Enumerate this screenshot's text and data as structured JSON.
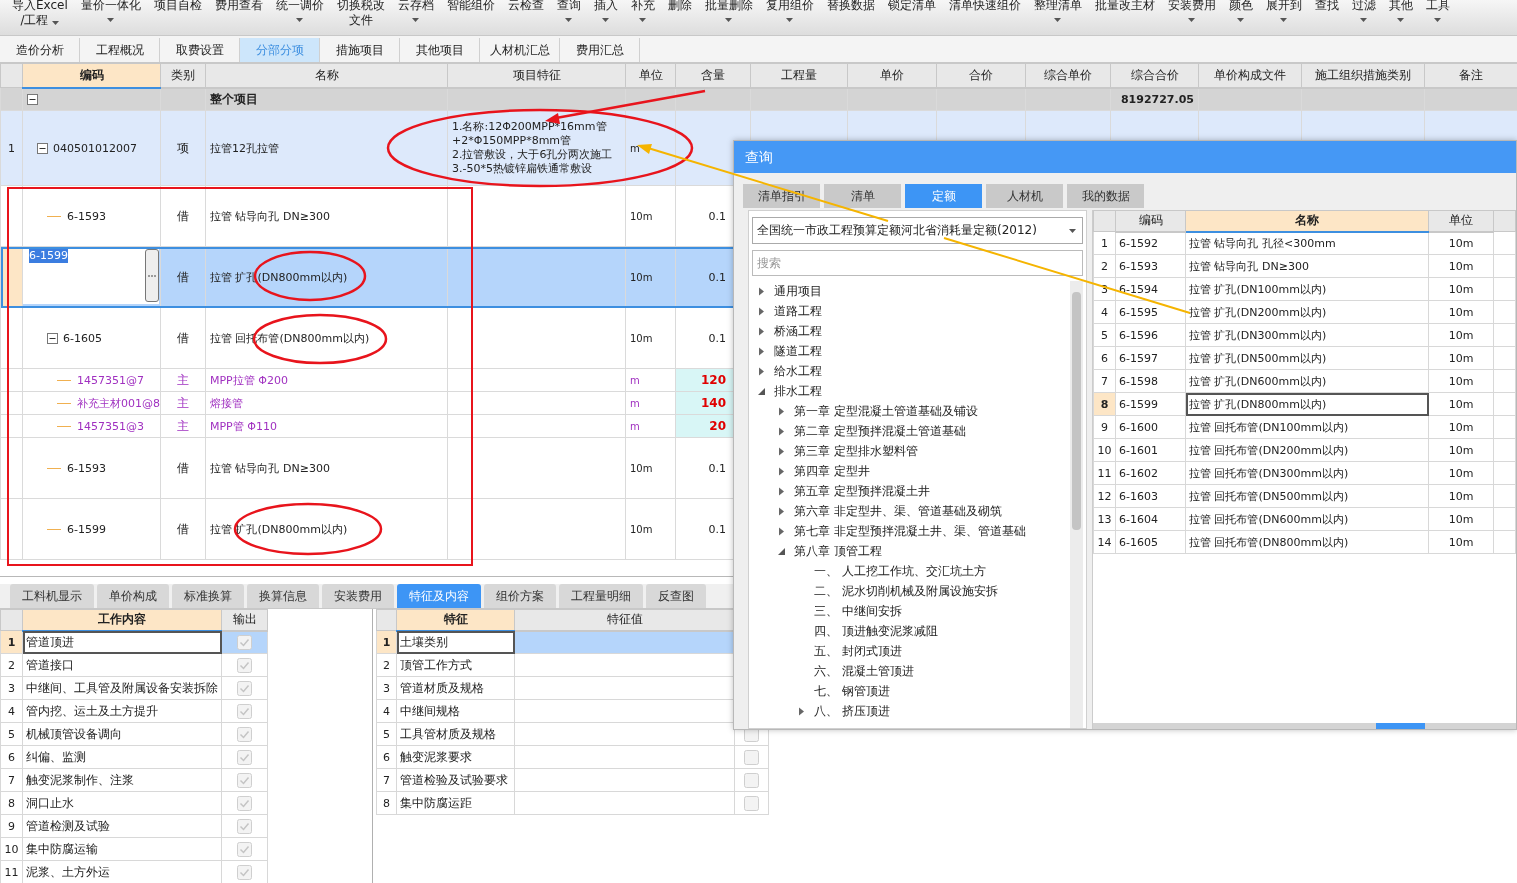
{
  "toolbar": [
    {
      "lines": [
        "导入Excel",
        "/工程"
      ],
      "has_menu": true
    },
    {
      "lines": [
        "量价一体化"
      ],
      "has_menu": true
    },
    {
      "lines": [
        "项目自检"
      ],
      "has_menu": false
    },
    {
      "lines": [
        "费用查看"
      ],
      "has_menu": false
    },
    {
      "lines": [
        "统一调价"
      ],
      "has_menu": true
    },
    {
      "lines": [
        "切换税改",
        "文件"
      ],
      "has_menu": false
    },
    {
      "lines": [
        "云存档"
      ],
      "has_menu": true
    },
    {
      "lines": [
        "智能组价"
      ],
      "has_menu": false
    },
    {
      "lines": [
        "云检查"
      ],
      "has_menu": false
    },
    {
      "lines": [
        "查询"
      ],
      "has_menu": true
    },
    {
      "lines": [
        "插入"
      ],
      "has_menu": true
    },
    {
      "lines": [
        "补充"
      ],
      "has_menu": true
    },
    {
      "lines": [
        "删除"
      ],
      "has_menu": false
    },
    {
      "lines": [
        "批量删除"
      ],
      "has_menu": true
    },
    {
      "lines": [
        "复用组价"
      ],
      "has_menu": true
    },
    {
      "lines": [
        "替换数据"
      ],
      "has_menu": false
    },
    {
      "lines": [
        "锁定清单"
      ],
      "has_menu": false
    },
    {
      "lines": [
        "清单快速组价"
      ],
      "has_menu": false
    },
    {
      "lines": [
        "整理清单"
      ],
      "has_menu": true
    },
    {
      "lines": [
        "批量改主材"
      ],
      "has_menu": false
    },
    {
      "lines": [
        "安装费用"
      ],
      "has_menu": true
    },
    {
      "lines": [
        "颜色"
      ],
      "has_menu": true
    },
    {
      "lines": [
        "展开到"
      ],
      "has_menu": true
    },
    {
      "lines": [
        "查找"
      ],
      "has_menu": false
    },
    {
      "lines": [
        "过滤"
      ],
      "has_menu": true
    },
    {
      "lines": [
        "其他"
      ],
      "has_menu": true
    },
    {
      "lines": [
        "工具"
      ],
      "has_menu": true
    }
  ],
  "view_tabs": [
    {
      "label": "造价分析",
      "selected": false
    },
    {
      "label": "工程概况",
      "selected": false
    },
    {
      "label": "取费设置",
      "selected": false
    },
    {
      "label": "分部分项",
      "selected": true
    },
    {
      "label": "措施项目",
      "selected": false
    },
    {
      "label": "其他项目",
      "selected": false
    },
    {
      "label": "人材机汇总",
      "selected": false
    },
    {
      "label": "费用汇总",
      "selected": false
    }
  ],
  "bill_table": {
    "columns": [
      {
        "label": "编码",
        "selected": true
      },
      {
        "label": "类别",
        "selected": false
      },
      {
        "label": "名称",
        "selected": false
      },
      {
        "label": "项目特征",
        "selected": false
      },
      {
        "label": "单位",
        "selected": false
      },
      {
        "label": "含量",
        "selected": false
      },
      {
        "label": "工程量",
        "selected": false
      },
      {
        "label": "单价",
        "selected": false
      },
      {
        "label": "合价",
        "selected": false
      },
      {
        "label": "综合单价",
        "selected": false
      },
      {
        "label": "综合合价",
        "selected": false
      },
      {
        "label": "单价构成文件",
        "selected": false
      },
      {
        "label": "施工组织措施类别",
        "selected": false
      },
      {
        "label": "备注",
        "selected": false
      }
    ],
    "rows": [
      {
        "kind": "root",
        "name": "整个项目",
        "total_price": "8192727.05",
        "selected": false,
        "expanded": true,
        "children": [
          {
            "kind": "bill",
            "row_no": "1",
            "code": "040501012007",
            "type": "项",
            "name": "拉管12孔拉管",
            "features": [
              "1.名称:12Φ200MPP*16mm管+2*Φ150MPP*8mm管",
              "2.拉管敷设，大于6孔分两次施工",
              "3.-50*5热镀锌扁铁通常敷设"
            ],
            "unit": "m",
            "selected": false,
            "expanded": true,
            "children": [
              {
                "kind": "quota",
                "code": "6-1593",
                "type": "借",
                "name": "拉管 钻导向孔 DN≥300",
                "unit": "10m",
                "amount": "0.1",
                "selected": false
              },
              {
                "kind": "quota",
                "code": "6-1599",
                "type": "借",
                "name": "拉管 扩孔(DN800mm以内)",
                "unit": "10m",
                "amount": "0.1",
                "selected": true
              },
              {
                "kind": "quota",
                "code": "6-1605",
                "type": "借",
                "name": "拉管 回托布管(DN800mm以内)",
                "unit": "10m",
                "amount": "0.1",
                "selected": false,
                "expanded": true,
                "children": [
                  {
                    "kind": "material",
                    "code": "1457351@7",
                    "type": "主",
                    "name": "MPP拉管 Φ200",
                    "unit": "m",
                    "amount": "120",
                    "selected": false
                  },
                  {
                    "kind": "material",
                    "code": "补充主材001@8",
                    "type": "主",
                    "name": "熔接管",
                    "unit": "m",
                    "amount": "140",
                    "selected": false
                  },
                  {
                    "kind": "material",
                    "code": "1457351@3",
                    "type": "主",
                    "name": "MPP管 Φ110",
                    "unit": "m",
                    "amount": "20",
                    "selected": false
                  }
                ]
              },
              {
                "kind": "quota",
                "code": "6-1593",
                "type": "借",
                "name": "拉管 钻导向孔 DN≥300",
                "unit": "10m",
                "amount": "0.1",
                "selected": false
              },
              {
                "kind": "quota",
                "code": "6-1599",
                "type": "借",
                "name": "拉管 扩孔(DN800mm以内)",
                "unit": "10m",
                "amount": "0.1",
                "selected": false
              }
            ]
          }
        ]
      }
    ]
  },
  "detail_tabs": [
    {
      "label": "工料机显示",
      "selected": false
    },
    {
      "label": "单价构成",
      "selected": false
    },
    {
      "label": "标准换算",
      "selected": false
    },
    {
      "label": "换算信息",
      "selected": false
    },
    {
      "label": "安装费用",
      "selected": false
    },
    {
      "label": "特征及内容",
      "selected": true
    },
    {
      "label": "组价方案",
      "selected": false
    },
    {
      "label": "工程量明细",
      "selected": false
    },
    {
      "label": "反查图",
      "selected": false
    }
  ],
  "work_content": {
    "columns": [
      {
        "label": "工作内容",
        "selected": true
      },
      {
        "label": "输出",
        "selected": false
      }
    ],
    "rows": [
      {
        "row_no": "1",
        "content": "管道顶进",
        "output": true,
        "selected": true
      },
      {
        "row_no": "2",
        "content": "管道接口",
        "output": true,
        "selected": false
      },
      {
        "row_no": "3",
        "content": "中继间、工具管及附属设备安装拆除",
        "output": true,
        "selected": false
      },
      {
        "row_no": "4",
        "content": "管内挖、运土及土方提升",
        "output": true,
        "selected": false
      },
      {
        "row_no": "5",
        "content": "机械顶管设备调向",
        "output": true,
        "selected": false
      },
      {
        "row_no": "6",
        "content": "纠偏、监测",
        "output": true,
        "selected": false
      },
      {
        "row_no": "7",
        "content": "触变泥浆制作、注浆",
        "output": true,
        "selected": false
      },
      {
        "row_no": "8",
        "content": "洞口止水",
        "output": true,
        "selected": false
      },
      {
        "row_no": "9",
        "content": "管道检测及试验",
        "output": true,
        "selected": false
      },
      {
        "row_no": "10",
        "content": "集中防腐运输",
        "output": true,
        "selected": false
      },
      {
        "row_no": "11",
        "content": "泥浆、土方外运",
        "output": true,
        "selected": false
      }
    ]
  },
  "features": {
    "columns": [
      {
        "label": "特征",
        "selected": true
      },
      {
        "label": "特征值",
        "selected": false
      }
    ],
    "rows": [
      {
        "row_no": "1",
        "name": "土壤类别",
        "selected": true
      },
      {
        "row_no": "2",
        "name": "顶管工作方式",
        "selected": false
      },
      {
        "row_no": "3",
        "name": "管道材质及规格",
        "selected": false
      },
      {
        "row_no": "4",
        "name": "中继间规格",
        "selected": false
      },
      {
        "row_no": "5",
        "name": "工具管材质及规格",
        "output": false,
        "selected": false
      },
      {
        "row_no": "6",
        "name": "触变泥浆要求",
        "output": false,
        "selected": false
      },
      {
        "row_no": "7",
        "name": "管道检验及试验要求",
        "output": false,
        "selected": false
      },
      {
        "row_no": "8",
        "name": "集中防腐运距",
        "output": false,
        "selected": false
      }
    ]
  },
  "dialog": {
    "title": "查询",
    "tabs": [
      {
        "label": "清单指引",
        "selected": false
      },
      {
        "label": "清单",
        "selected": false
      },
      {
        "label": "定额",
        "selected": true
      },
      {
        "label": "人材机",
        "selected": false
      },
      {
        "label": "我的数据",
        "selected": false
      }
    ],
    "library": "全国统一市政工程预算定额河北省消耗量定额(2012)",
    "search": {
      "placeholder": "搜索"
    },
    "tree": [
      {
        "label": "通用项目",
        "expanded": false
      },
      {
        "label": "道路工程",
        "expanded": false
      },
      {
        "label": "桥涵工程",
        "expanded": false
      },
      {
        "label": "隧道工程",
        "expanded": false
      },
      {
        "label": "给水工程",
        "expanded": false
      },
      {
        "label": "排水工程",
        "expanded": true,
        "children": [
          {
            "label": "第一章 定型混凝土管道基础及铺设",
            "expanded": false
          },
          {
            "label": "第二章 定型预拌混凝土管道基础",
            "expanded": false
          },
          {
            "label": "第三章 定型排水塑料管",
            "expanded": false
          },
          {
            "label": "第四章 定型井",
            "expanded": false
          },
          {
            "label": "第五章 定型预拌混凝土井",
            "expanded": false
          },
          {
            "label": "第六章 非定型井、渠、管道基础及砌筑",
            "expanded": false
          },
          {
            "label": "第七章 非定型预拌混凝土井、渠、管道基础",
            "expanded": false
          },
          {
            "label": "第八章 顶管工程",
            "expanded": true,
            "children": [
              {
                "label": "一、 人工挖工作坑、交汇坑土方"
              },
              {
                "label": "二、 泥水切削机械及附属设施安拆"
              },
              {
                "label": "三、 中继间安拆"
              },
              {
                "label": "四、 顶进触变泥浆减阻"
              },
              {
                "label": "五、 封闭式顶进"
              },
              {
                "label": "六、 混凝土管顶进"
              },
              {
                "label": "七、 钢管顶进"
              },
              {
                "label": "八、 挤压顶进",
                "expanded": false
              }
            ]
          }
        ]
      }
    ],
    "results": {
      "columns": [
        {
          "label": "编码",
          "selected": false
        },
        {
          "label": "名称",
          "selected": true
        },
        {
          "label": "单位",
          "selected": false
        }
      ],
      "rows": [
        {
          "row_no": "1",
          "code": "6-1592",
          "name": "拉管 钻导向孔 孔径<300mm",
          "unit": "10m",
          "selected": false
        },
        {
          "row_no": "2",
          "code": "6-1593",
          "name": "拉管 钻导向孔 DN≥300",
          "unit": "10m",
          "selected": false
        },
        {
          "row_no": "3",
          "code": "6-1594",
          "name": "拉管 扩孔(DN100mm以内)",
          "unit": "10m",
          "selected": false
        },
        {
          "row_no": "4",
          "code": "6-1595",
          "name": "拉管 扩孔(DN200mm以内)",
          "unit": "10m",
          "selected": false
        },
        {
          "row_no": "5",
          "code": "6-1596",
          "name": "拉管 扩孔(DN300mm以内)",
          "unit": "10m",
          "selected": false
        },
        {
          "row_no": "6",
          "code": "6-1597",
          "name": "拉管 扩孔(DN500mm以内)",
          "unit": "10m",
          "selected": false
        },
        {
          "row_no": "7",
          "code": "6-1598",
          "name": "拉管 扩孔(DN600mm以内)",
          "unit": "10m",
          "selected": false
        },
        {
          "row_no": "8",
          "code": "6-1599",
          "name": "拉管 扩孔(DN800mm以内)",
          "unit": "10m",
          "selected": true
        },
        {
          "row_no": "9",
          "code": "6-1600",
          "name": "拉管 回托布管(DN100mm以内)",
          "unit": "10m",
          "selected": false
        },
        {
          "row_no": "10",
          "code": "6-1601",
          "name": "拉管 回托布管(DN200mm以内)",
          "unit": "10m",
          "selected": false
        },
        {
          "row_no": "11",
          "code": "6-1602",
          "name": "拉管 回托布管(DN300mm以内)",
          "unit": "10m",
          "selected": false
        },
        {
          "row_no": "12",
          "code": "6-1603",
          "name": "拉管 回托布管(DN500mm以内)",
          "unit": "10m",
          "selected": false
        },
        {
          "row_no": "13",
          "code": "6-1604",
          "name": "拉管 回托布管(DN600mm以内)",
          "unit": "10m",
          "selected": false
        },
        {
          "row_no": "14",
          "code": "6-1605",
          "name": "拉管 回托布管(DN800mm以内)",
          "unit": "10m",
          "selected": false
        }
      ]
    }
  }
}
